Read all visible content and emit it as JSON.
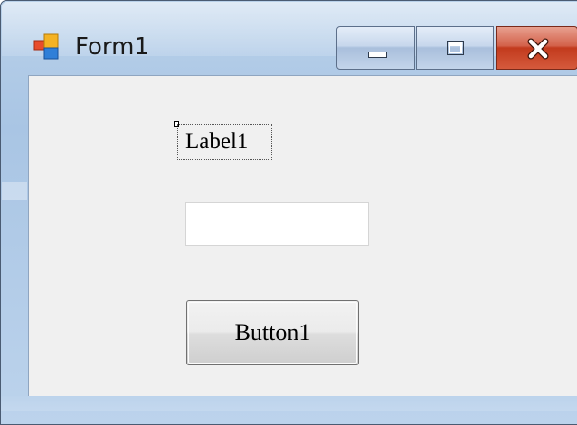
{
  "window": {
    "title": "Form1",
    "icon": "winforms-app-icon",
    "controls": {
      "minimize_icon": "minimize-icon",
      "maximize_icon": "maximize-icon",
      "close_icon": "close-icon"
    }
  },
  "form": {
    "label1": {
      "text": "Label1"
    },
    "textbox1": {
      "value": "",
      "placeholder": ""
    },
    "button1": {
      "text": "Button1"
    }
  },
  "colors": {
    "frame": "#b9d1ea",
    "client_background": "#f0f0f0",
    "close_button": "#c23a1d"
  }
}
